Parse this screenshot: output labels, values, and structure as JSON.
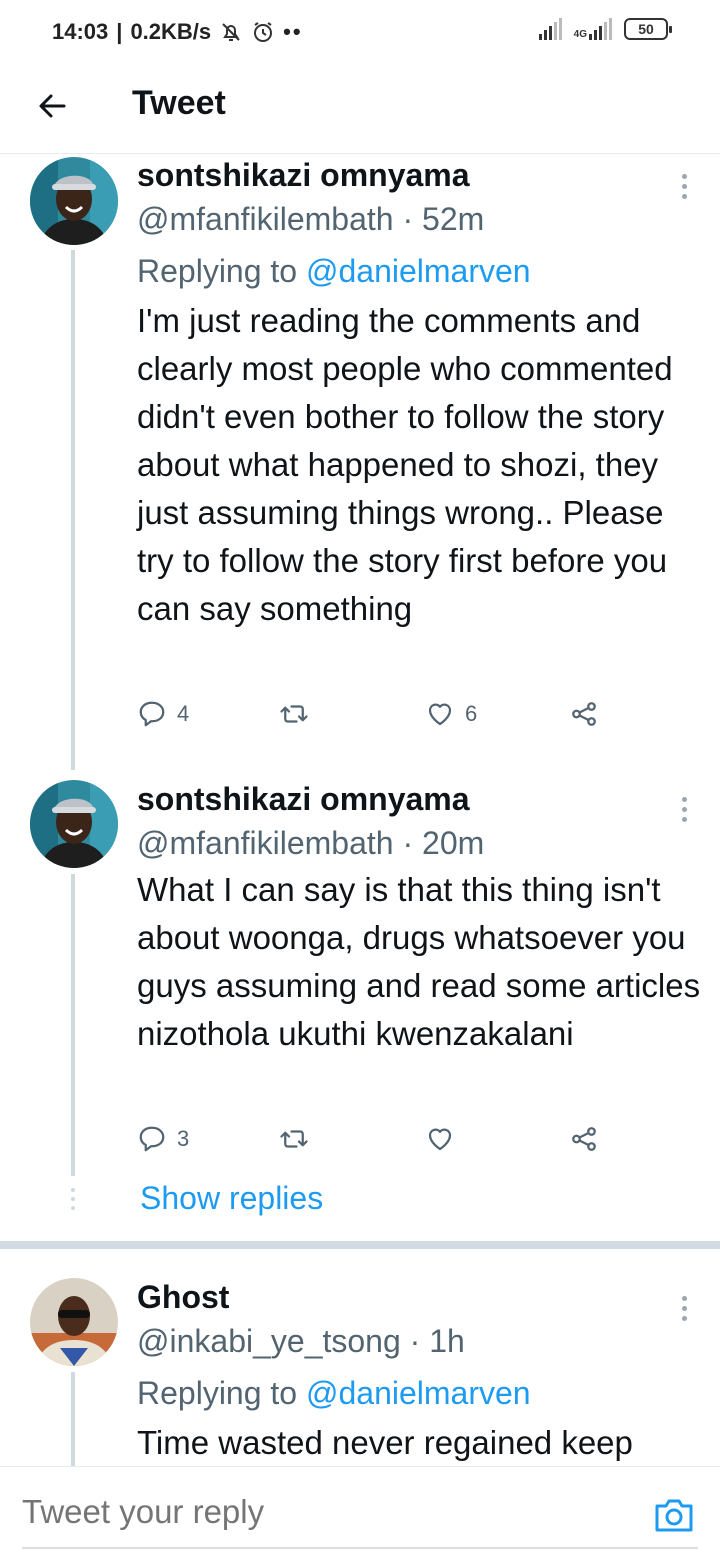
{
  "status_bar": {
    "time": "14:03",
    "speed": "0.2KB/s",
    "network": "4G",
    "battery": "50"
  },
  "header": {
    "title": "Tweet"
  },
  "tweets": [
    {
      "name": "sontshikazi omnyama",
      "handle": "@mfanfikilembath · 52m",
      "replying_prefix": "Replying to ",
      "replying_to": "@danielmarven",
      "text": "I'm just reading the comments and clearly most people who commented didn't even bother to follow the story about what happened to shozi, they just assuming things wrong.. Please try to follow the story first before you can say something",
      "reply_count": "4",
      "retweet_count": "",
      "like_count": "6"
    },
    {
      "name": "sontshikazi omnyama",
      "handle": "@mfanfikilembath · 20m",
      "text": "What I can say is that this thing isn't about woonga, drugs whatsoever you guys assuming and read some articles nizothola ukuthi kwenzakalani",
      "reply_count": "3",
      "retweet_count": "",
      "like_count": ""
    },
    {
      "name": "Ghost",
      "handle": "@inkabi_ye_tsong · 1h",
      "replying_prefix": "Replying to ",
      "replying_to": "@danielmarven",
      "text": "Time wasted never regained keep"
    }
  ],
  "show_replies": "Show replies",
  "reply_bar": {
    "placeholder": "Tweet your reply"
  },
  "colors": {
    "accent": "#1d9bf0",
    "muted": "#536471",
    "thread_line": "#cfd9de"
  },
  "icons": {
    "back": "arrow-left-icon",
    "reply": "reply-icon",
    "retweet": "retweet-icon",
    "like": "heart-icon",
    "share": "share-icon",
    "more": "more-vertical-icon",
    "camera": "camera-icon"
  }
}
